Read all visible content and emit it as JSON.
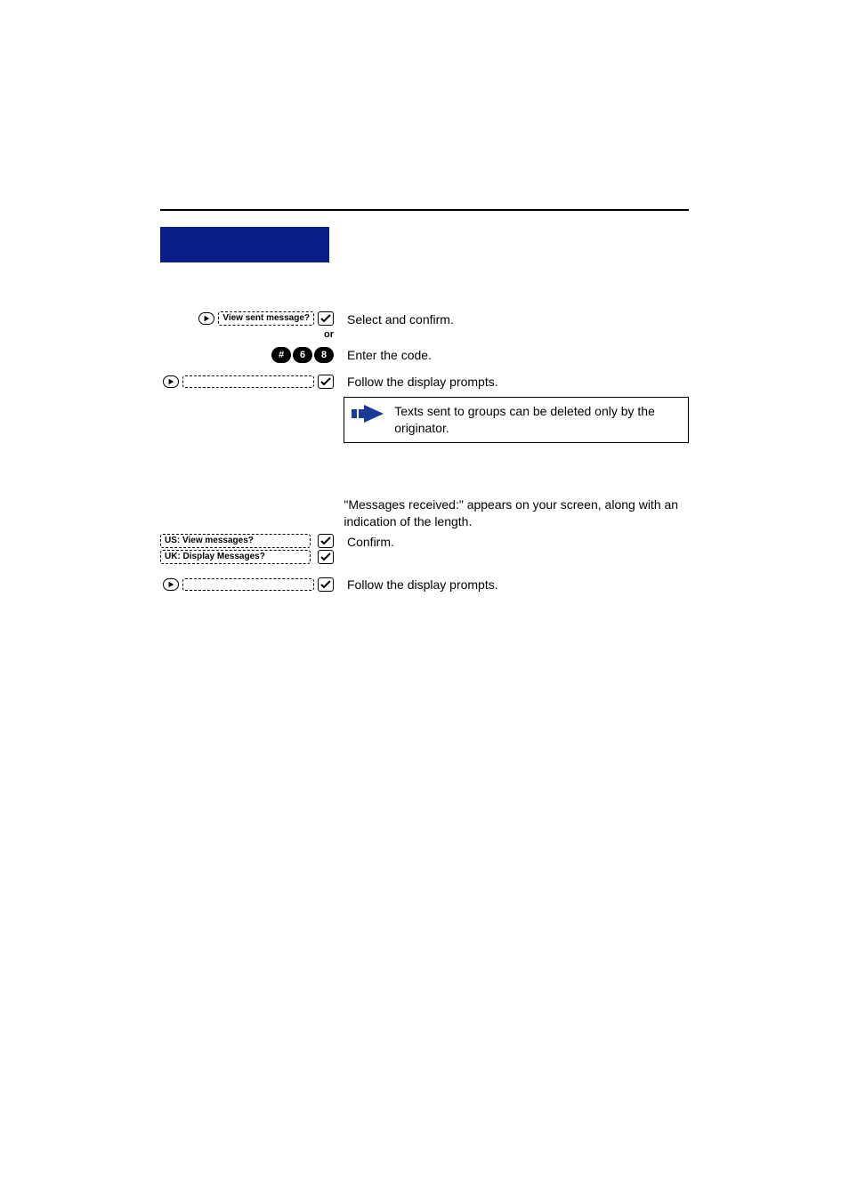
{
  "row1": {
    "pill_label": "View sent message?",
    "right_text": "Select and confirm.",
    "or_label": "or"
  },
  "keys_row": {
    "k1": "#",
    "k2": "6",
    "k3": "8",
    "right_text": "Enter the code."
  },
  "follow1": {
    "right_text": "Follow the display prompts."
  },
  "note": {
    "text": "Texts sent to groups can be deleted only by the originator."
  },
  "received_intro": {
    "text": "\"Messages received:\" appears on your screen, along with an indication of the length."
  },
  "confirm_row": {
    "pill_us": "US: View messages?",
    "pill_uk": "UK: Display Messages?",
    "right_text": "Confirm."
  },
  "follow2": {
    "right_text": "Follow the display prompts."
  }
}
